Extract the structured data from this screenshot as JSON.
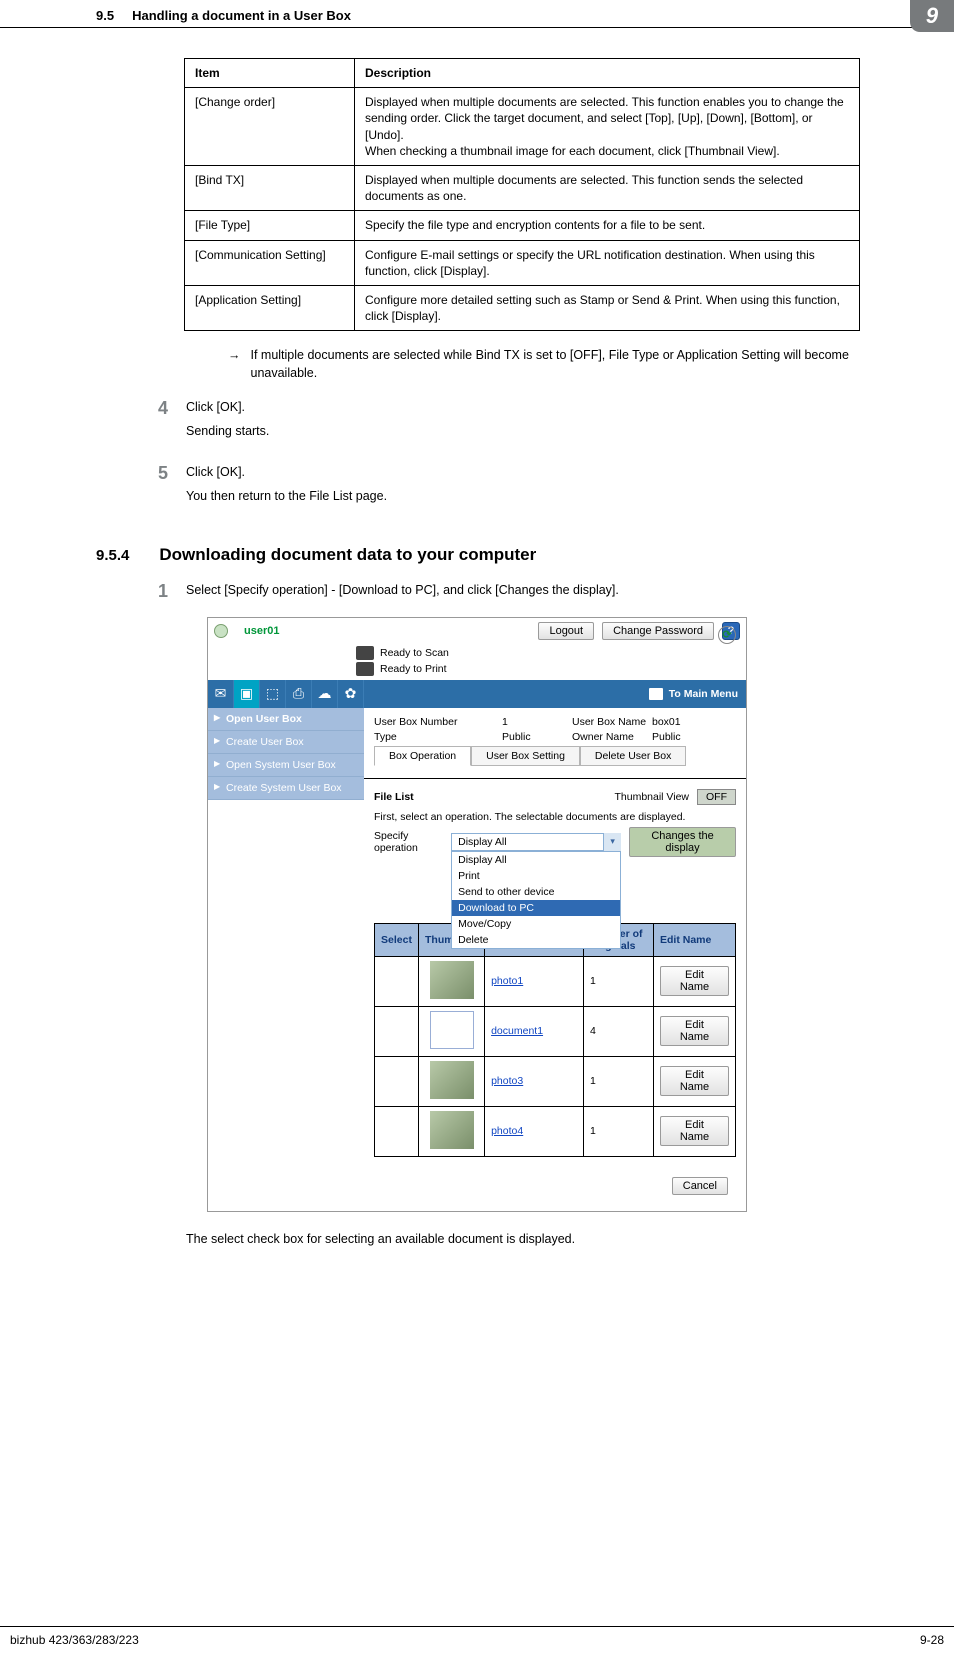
{
  "header": {
    "section_number": "9.5",
    "section_title": "Handling a document in a User Box",
    "chapter_badge": "9"
  },
  "desc_table": {
    "head_item": "Item",
    "head_desc": "Description",
    "rows": [
      {
        "item": "[Change order]",
        "desc": "Displayed when multiple documents are selected. This function enables you to change the sending order. Click the target document, and select [Top], [Up], [Down], [Bottom], or [Undo].\nWhen checking a thumbnail image for each document, click [Thumbnail View]."
      },
      {
        "item": "[Bind TX]",
        "desc": "Displayed when multiple documents are selected. This function sends the selected documents as one."
      },
      {
        "item": "[File Type]",
        "desc": "Specify the file type and encryption contents for a file to be sent."
      },
      {
        "item": "[Communication Setting]",
        "desc": "Configure E-mail settings or specify the URL notification destination. When using this function, click [Display]."
      },
      {
        "item": "[Application Setting]",
        "desc": "Configure more detailed setting such as Stamp or Send & Print. When using this function, click [Display]."
      }
    ]
  },
  "arrow_note": "If multiple documents are selected while Bind TX is set to [OFF], File Type or Application Setting will become unavailable.",
  "steps": [
    {
      "num": "4",
      "lines": [
        "Click [OK].",
        "Sending starts."
      ]
    },
    {
      "num": "5",
      "lines": [
        "Click [OK].",
        "You then return to the File List page."
      ]
    }
  ],
  "subsection": {
    "num": "9.5.4",
    "title": "Downloading document data to your computer"
  },
  "step_after": {
    "num": "1",
    "text": "Select [Specify operation] - [Download to PC], and click [Changes the display]."
  },
  "webapp": {
    "user": "user01",
    "logout": "Logout",
    "change_pw": "Change Password",
    "status_scan": "Ready to Scan",
    "status_print": "Ready to Print",
    "to_main": "To Main Menu",
    "nav": {
      "items": [
        "Open User Box",
        "Create User Box",
        "Open System User Box",
        "Create System User Box"
      ]
    },
    "meta": {
      "box_num_label": "User Box Number",
      "box_num_value": "1",
      "box_name_label": "User Box Name",
      "box_name_value": "box01",
      "type_label": "Type",
      "type_value": "Public",
      "owner_label": "Owner Name",
      "owner_value": "Public",
      "tabs": [
        "Box Operation",
        "User Box Setting",
        "Delete User Box"
      ]
    },
    "filelist": {
      "title": "File List",
      "thumb_label": "Thumbnail View",
      "thumb_off": "OFF",
      "note": "First, select an operation. The selectable documents are displayed.",
      "spec_label": "Specify operation",
      "spec_selected": "Display All",
      "changes_btn": "Changes the display",
      "dropdown": [
        "Display All",
        "Print",
        "Send to other device",
        "Download to PC",
        "Move/Copy",
        "Delete"
      ],
      "th_select": "Select",
      "th_thumb": "Thumbnail",
      "th_num": "Number of Originals",
      "th_edit": "Edit Name",
      "edit_label": "Edit Name",
      "docs": [
        {
          "name": "photo1",
          "count": "1",
          "kind": "photo"
        },
        {
          "name": "document1",
          "count": "4",
          "kind": "doc"
        },
        {
          "name": "photo3",
          "count": "1",
          "kind": "photo"
        },
        {
          "name": "photo4",
          "count": "1",
          "kind": "photo"
        }
      ],
      "cancel": "Cancel"
    }
  },
  "select_note": "The select check box for selecting an available document is displayed.",
  "footer": {
    "left": "bizhub 423/363/283/223",
    "right": "9-28"
  }
}
